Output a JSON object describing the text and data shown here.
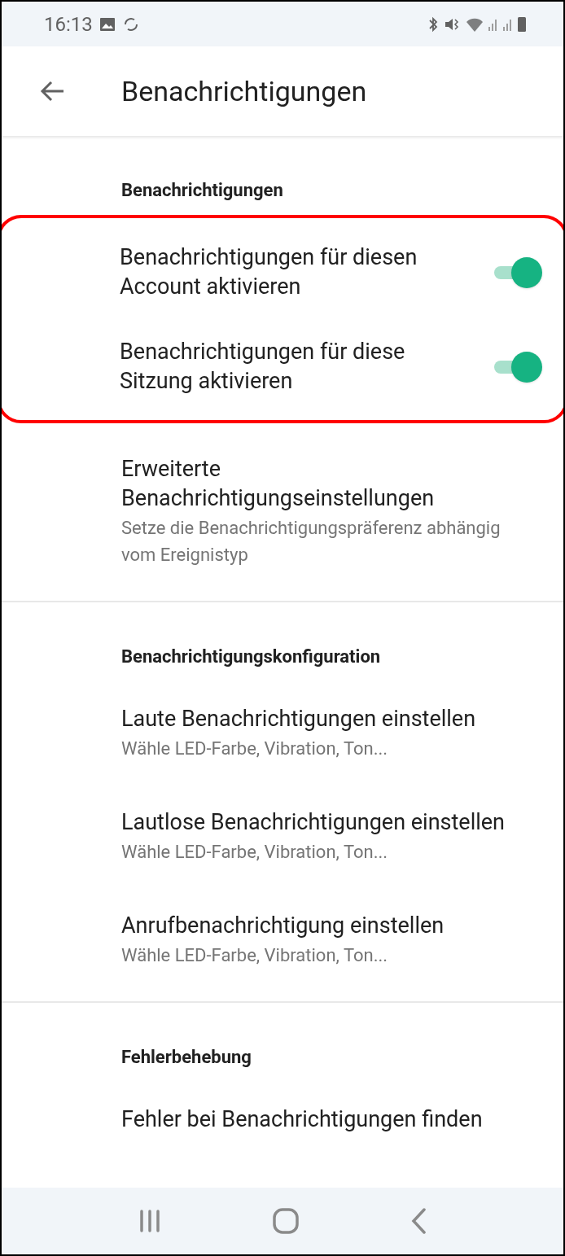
{
  "status_bar": {
    "time": "16:13"
  },
  "app_bar": {
    "title": "Benachrichtigungen"
  },
  "sections": [
    {
      "header": "Benachrichtigungen",
      "highlighted_items": [
        {
          "kind": "toggle",
          "title": "Benachrichtigungen für diesen Account aktivieren",
          "on": true
        },
        {
          "kind": "toggle",
          "title": "Benachrichtigungen für diese Sitzung aktivieren",
          "on": true
        }
      ],
      "items": [
        {
          "kind": "link",
          "title": "Erweiterte Benachrichtigungseinstellungen",
          "subtitle": "Setze die Benachrichtigungspräferenz abhängig vom Ereignistyp"
        }
      ]
    },
    {
      "header": "Benachrichtigungskonfiguration",
      "items": [
        {
          "kind": "link",
          "title": "Laute Benachrichtigungen einstellen",
          "subtitle": "Wähle LED-Farbe, Vibration, Ton..."
        },
        {
          "kind": "link",
          "title": "Lautlose Benachrichtigungen einstellen",
          "subtitle": "Wähle LED-Farbe, Vibration, Ton..."
        },
        {
          "kind": "link",
          "title": "Anrufbenachrichtigung einstellen",
          "subtitle": "Wähle LED-Farbe, Vibration, Ton..."
        }
      ]
    },
    {
      "header": "Fehlerbehebung",
      "items": [
        {
          "kind": "link",
          "title": "Fehler bei Benachrichtigungen finden"
        }
      ]
    }
  ]
}
